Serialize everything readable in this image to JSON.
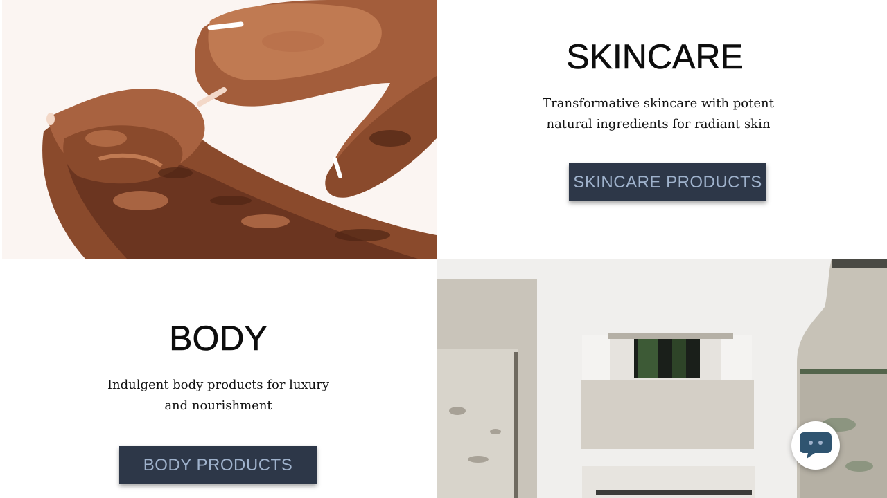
{
  "sections": {
    "skincare": {
      "title": "SKINCARE",
      "description": "Transformative skincare with potent natural ingredients for radiant skin",
      "button_label": "SKINCARE PRODUCTS"
    },
    "body": {
      "title": "BODY",
      "description": "Indulgent body products for luxury and nourishment",
      "button_label": "BODY PRODUCTS"
    }
  },
  "images": {
    "skincare": "hands-applying-product-image",
    "body": "cosmetic-jars-image"
  },
  "chat": {
    "icon": "chat-bubble-icon"
  },
  "colors": {
    "button_bg": "#2d3748",
    "button_text": "#9fb2cc",
    "chat_icon": "#2f5470",
    "heading": "#0d0d0d"
  }
}
